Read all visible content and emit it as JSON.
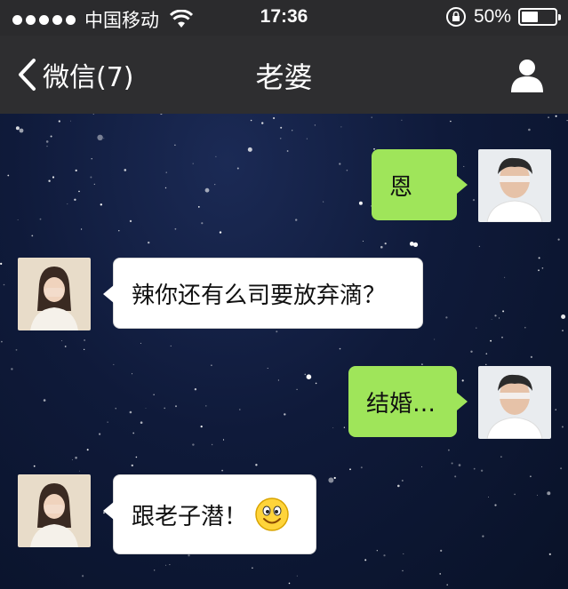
{
  "status": {
    "carrier": "中国移动",
    "time": "17:36",
    "battery": "50%",
    "battery_level": 0.5
  },
  "nav": {
    "back_label": "微信(7)",
    "title": "老婆"
  },
  "messages": [
    {
      "side": "me",
      "text": "恩"
    },
    {
      "side": "them",
      "text": "辣你还有么司要放弃滴？"
    },
    {
      "side": "me",
      "text": "结婚…"
    },
    {
      "side": "them",
      "text": "跟老子潜！",
      "emoji": "smiley-emoji"
    }
  ],
  "icons": {
    "back": "chevron-left-icon",
    "profile": "person-icon",
    "wifi": "wifi-icon",
    "lock": "rotation-lock-icon",
    "battery": "battery-icon"
  },
  "colors": {
    "navbar": "#2e2e30",
    "me_bubble": "#9fe55a",
    "them_bubble": "#ffffff"
  }
}
